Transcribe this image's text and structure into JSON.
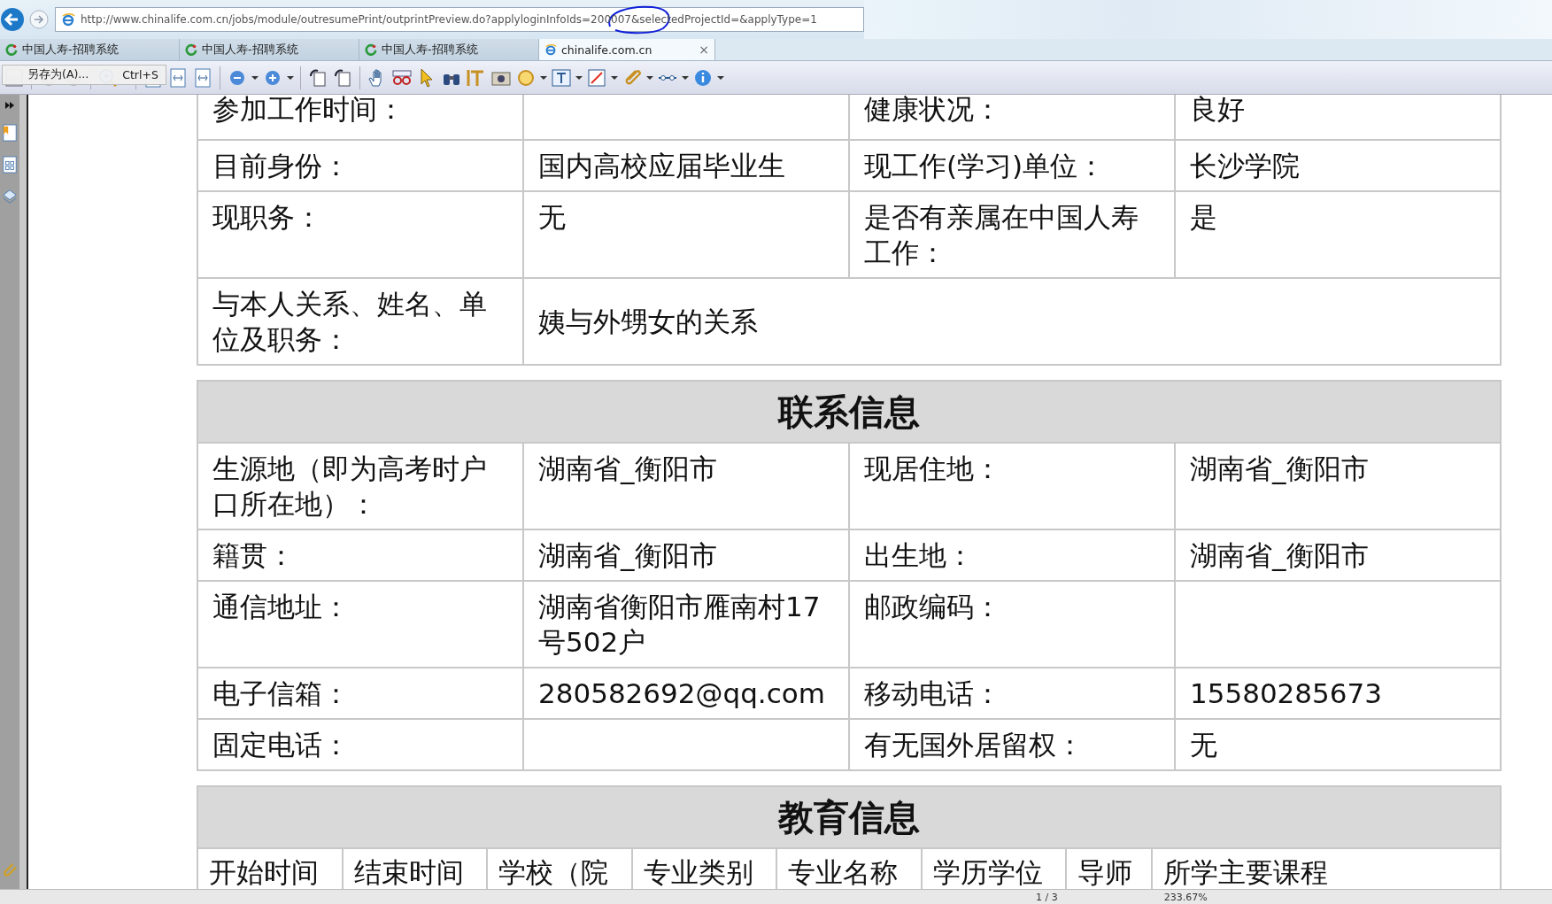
{
  "browser": {
    "url": "http://www.chinalife.com.cn/jobs/module/outresumePrint/outprintPreview.do?applyloginInfoIds=200007&selectedProjectId=&applyType=1",
    "tabs": [
      {
        "label": "中国人寿-招聘系统",
        "selected": false
      },
      {
        "label": "中国人寿-招聘系统",
        "selected": false
      },
      {
        "label": "中国人寿-招聘系统",
        "selected": false
      },
      {
        "label": "chinalife.com.cn",
        "selected": true,
        "close": "×"
      }
    ],
    "context_menu": {
      "label": "另存为(A)...",
      "shortcut": "Ctrl+S"
    }
  },
  "document": {
    "blocks": [
      {
        "kind": "table",
        "rows": [
          {
            "kind": "quad",
            "cells": [
              "参加工作时间：",
              "",
              "健康状况：",
              "良好"
            ]
          },
          {
            "kind": "quad",
            "cells": [
              "目前身份：",
              "国内高校应届毕业生",
              "现工作(学习)单位：",
              "长沙学院"
            ]
          },
          {
            "kind": "quad",
            "cells": [
              "现职务：",
              "无",
              "是否有亲属在中国人寿工作：",
              "是"
            ]
          },
          {
            "kind": "wide",
            "cells": [
              {
                "text": "与本人关系、姓名、单位及职务："
              },
              {
                "text": "姨与外甥女的关系",
                "colspan": 3
              }
            ]
          }
        ]
      },
      {
        "kind": "heading",
        "title": "联系信息"
      },
      {
        "kind": "table",
        "rows": [
          {
            "kind": "quad",
            "cells": [
              "生源地（即为高考时户口所在地）：",
              "湖南省_衡阳市",
              "现居住地：",
              "湖南省_衡阳市"
            ]
          },
          {
            "kind": "quad",
            "cells": [
              "籍贯：",
              "湖南省_衡阳市",
              "出生地：",
              "湖南省_衡阳市"
            ]
          },
          {
            "kind": "quad",
            "cells": [
              "通信地址：",
              "湖南省衡阳市雁南村17号502户",
              "邮政编码：",
              ""
            ]
          },
          {
            "kind": "quad",
            "cells": [
              "电子信箱：",
              "280582692@qq.com",
              "移动电话：",
              "15580285673"
            ]
          },
          {
            "kind": "quad",
            "cells": [
              "固定电话：",
              "",
              "有无国外居留权：",
              "无"
            ]
          }
        ]
      },
      {
        "kind": "heading",
        "title": "教育信息"
      },
      {
        "kind": "columns",
        "cells": [
          "开始时间",
          "结束时间",
          "学校（院",
          "专业类别",
          "专业名称",
          "学历学位",
          "导师",
          "所学主要课程"
        ]
      }
    ]
  },
  "status_bar": {
    "page": "1 / 3",
    "zoom": "233.67%"
  }
}
